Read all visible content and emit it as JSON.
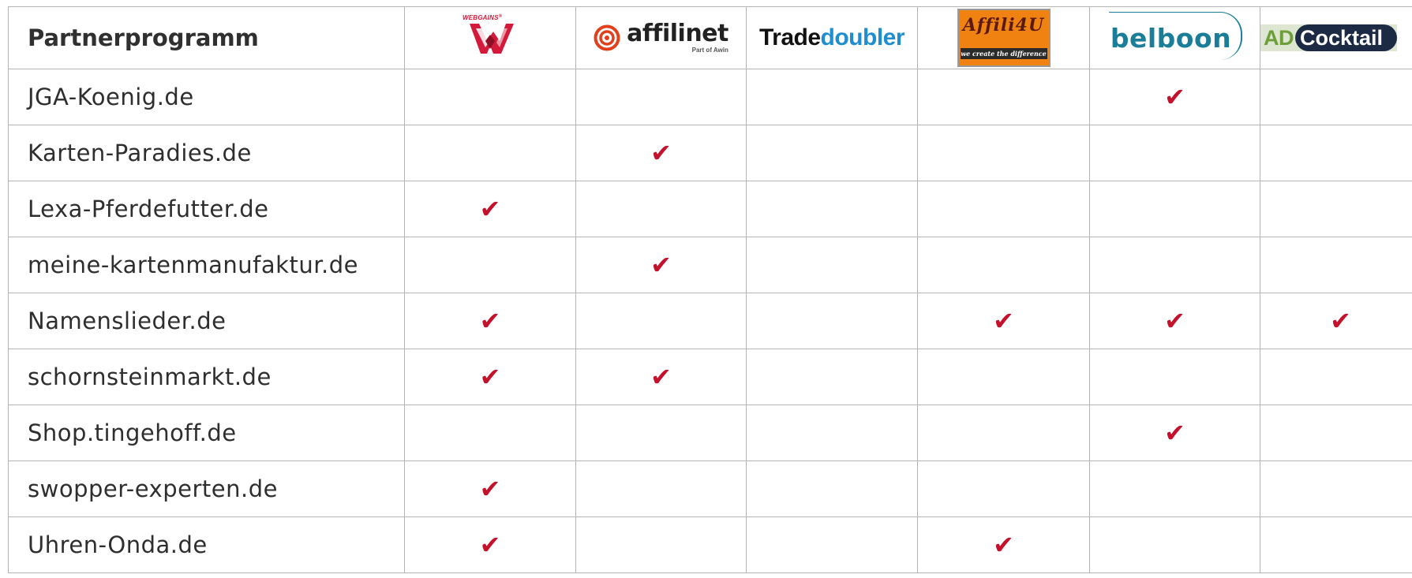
{
  "header": {
    "label": "Partnerprogramm"
  },
  "networks": {
    "webgains": {
      "brand": "WEBGAINS",
      "reg": "®",
      "icon": "webgains-w-logo-icon",
      "color": "#d41a3a"
    },
    "affilinet": {
      "name": "affilinet",
      "sub": "Part of Awin",
      "icon": "target-rings-icon",
      "color": "#e2401b"
    },
    "tradedoubler": {
      "part1": "Trade",
      "part2": "doubler",
      "color1": "#111111",
      "color2": "#1f8ed0"
    },
    "affili4u": {
      "name": "Affili4U",
      "tagline": "we create the difference",
      "color": "#f08212"
    },
    "belboon": {
      "name": "belboon",
      "color": "#1b7e99"
    },
    "adcocktail": {
      "prefix": "AD",
      "name": "Cocktail",
      "color1": "#6d9e38",
      "color2": "#1c2a44"
    }
  },
  "check_symbol": "✔",
  "check_color": "#c4112c",
  "columns": [
    "webgains",
    "affilinet",
    "tradedoubler",
    "affili4u",
    "belboon",
    "adcocktail"
  ],
  "rows": [
    {
      "name": "JGA-Koenig.de",
      "marks": [
        false,
        false,
        false,
        false,
        true,
        false
      ]
    },
    {
      "name": "Karten-Paradies.de",
      "marks": [
        false,
        true,
        false,
        false,
        false,
        false
      ]
    },
    {
      "name": "Lexa-Pferdefutter.de",
      "marks": [
        true,
        false,
        false,
        false,
        false,
        false
      ]
    },
    {
      "name": "meine-kartenmanufaktur.de",
      "marks": [
        false,
        true,
        false,
        false,
        false,
        false
      ]
    },
    {
      "name": "Namenslieder.de",
      "marks": [
        true,
        false,
        false,
        true,
        true,
        true
      ]
    },
    {
      "name": "schornsteinmarkt.de",
      "marks": [
        true,
        true,
        false,
        false,
        false,
        false
      ]
    },
    {
      "name": "Shop.tingehoff.de",
      "marks": [
        false,
        false,
        false,
        false,
        true,
        false
      ]
    },
    {
      "name": "swopper-experten.de",
      "marks": [
        true,
        false,
        false,
        false,
        false,
        false
      ]
    },
    {
      "name": "Uhren-Onda.de",
      "marks": [
        true,
        false,
        false,
        true,
        false,
        false
      ]
    }
  ]
}
